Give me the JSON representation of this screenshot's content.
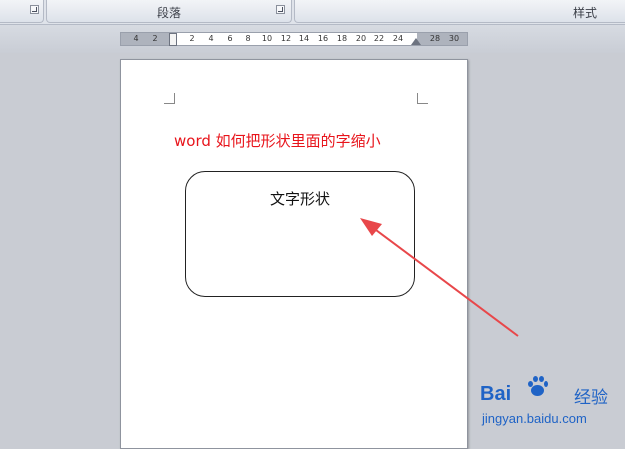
{
  "ribbon": {
    "paragraph_label": "段落",
    "styles_label": "样式"
  },
  "ruler": {
    "ticks": [
      "4",
      "2",
      "2",
      "4",
      "6",
      "8",
      "10",
      "12",
      "14",
      "16",
      "18",
      "20",
      "22",
      "24",
      "28",
      "30"
    ]
  },
  "document": {
    "title_text": "word 如何把形状里面的字缩小",
    "shape_text": "文字形状"
  },
  "watermark": {
    "brand_left": "Bai",
    "brand_right": "经验",
    "url": "jingyan.baidu.com"
  },
  "colors": {
    "title": "#e8141b",
    "arrow": "#e8474a",
    "watermark": "#1f63c6"
  }
}
